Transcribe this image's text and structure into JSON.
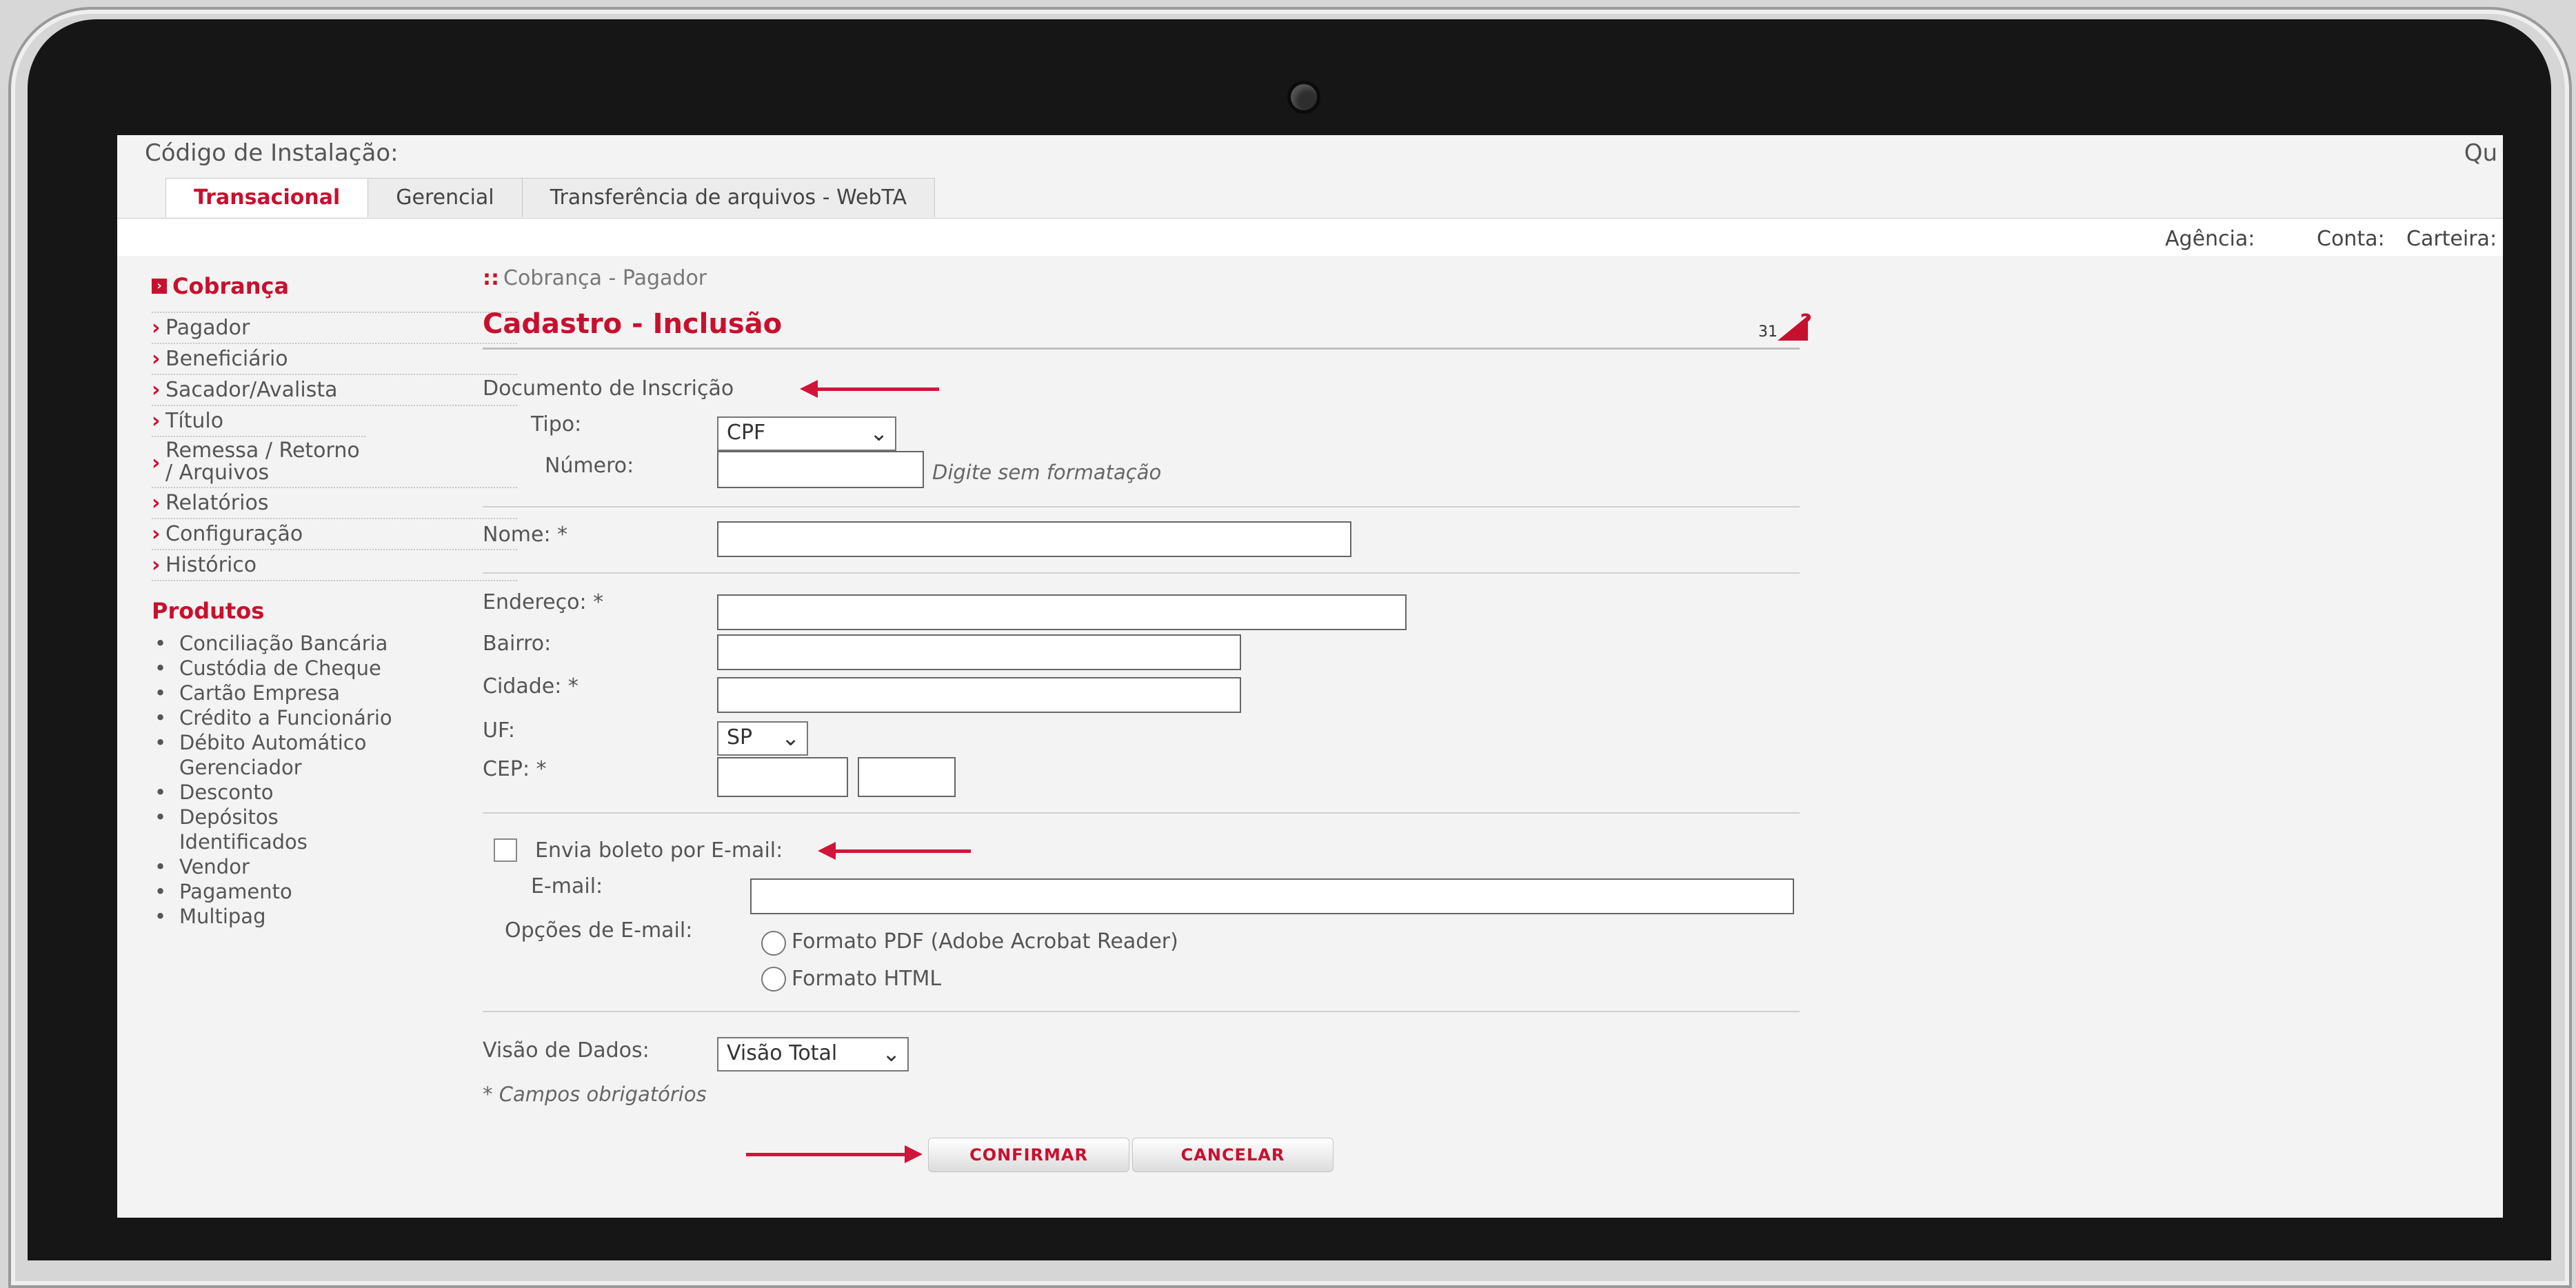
{
  "header": {
    "installation_label": "Código de Instalação:",
    "right_clip": "Qu"
  },
  "tabs": [
    {
      "label": "Transacional",
      "active": true
    },
    {
      "label": "Gerencial",
      "active": false
    },
    {
      "label": "Transferência de arquivos - WebTA",
      "active": false
    }
  ],
  "account_bar": {
    "agencia": "Agência:",
    "conta": "Conta:",
    "carteira": "Carteira:"
  },
  "sidebar": {
    "section_title": "Cobrança",
    "items": [
      {
        "label": "Pagador"
      },
      {
        "label": "Beneficiário"
      },
      {
        "label": "Sacador/Avalista"
      },
      {
        "label": "Título"
      },
      {
        "label": "Remessa / Retorno / Arquivos"
      },
      {
        "label": "Relatórios"
      },
      {
        "label": "Configuração"
      },
      {
        "label": "Histórico"
      }
    ],
    "products_title": "Produtos",
    "products": [
      "Conciliação Bancária",
      "Custódia de Cheque",
      "Cartão Empresa",
      "Crédito a Funcionário",
      "Débito Automático Gerenciador",
      "Desconto",
      "Depósitos Identificados",
      "Vendor",
      "Pagamento",
      "Multipag"
    ]
  },
  "main": {
    "breadcrumb": "Cobrança - Pagador",
    "title": "Cadastro - Inclusão",
    "help_number": "31",
    "doc_section": "Documento de Inscrição",
    "tipo_label": "Tipo:",
    "tipo_value": "CPF",
    "numero_label": "Número:",
    "numero_hint": "Digite sem formatação",
    "nome_label": "Nome: *",
    "endereco_label": "Endereço: *",
    "bairro_label": "Bairro:",
    "cidade_label": "Cidade: *",
    "uf_label": "UF:",
    "uf_value": "SP",
    "cep_label": "CEP: *",
    "email_checkbox_label": "Envia boleto por E-mail:",
    "email_label": "E-mail:",
    "email_options_label": "Opções de E-mail:",
    "option_pdf": "Formato PDF (Adobe Acrobat Reader)",
    "option_html": "Formato HTML",
    "visao_label": "Visão de Dados:",
    "visao_value": "Visão Total",
    "required_note": "* Campos obrigatórios",
    "confirm_label": "CONFIRMAR",
    "cancel_label": "CANCELAR"
  },
  "colors": {
    "brand_red": "#c8102e",
    "annotation_arrow": "#d2143a"
  }
}
